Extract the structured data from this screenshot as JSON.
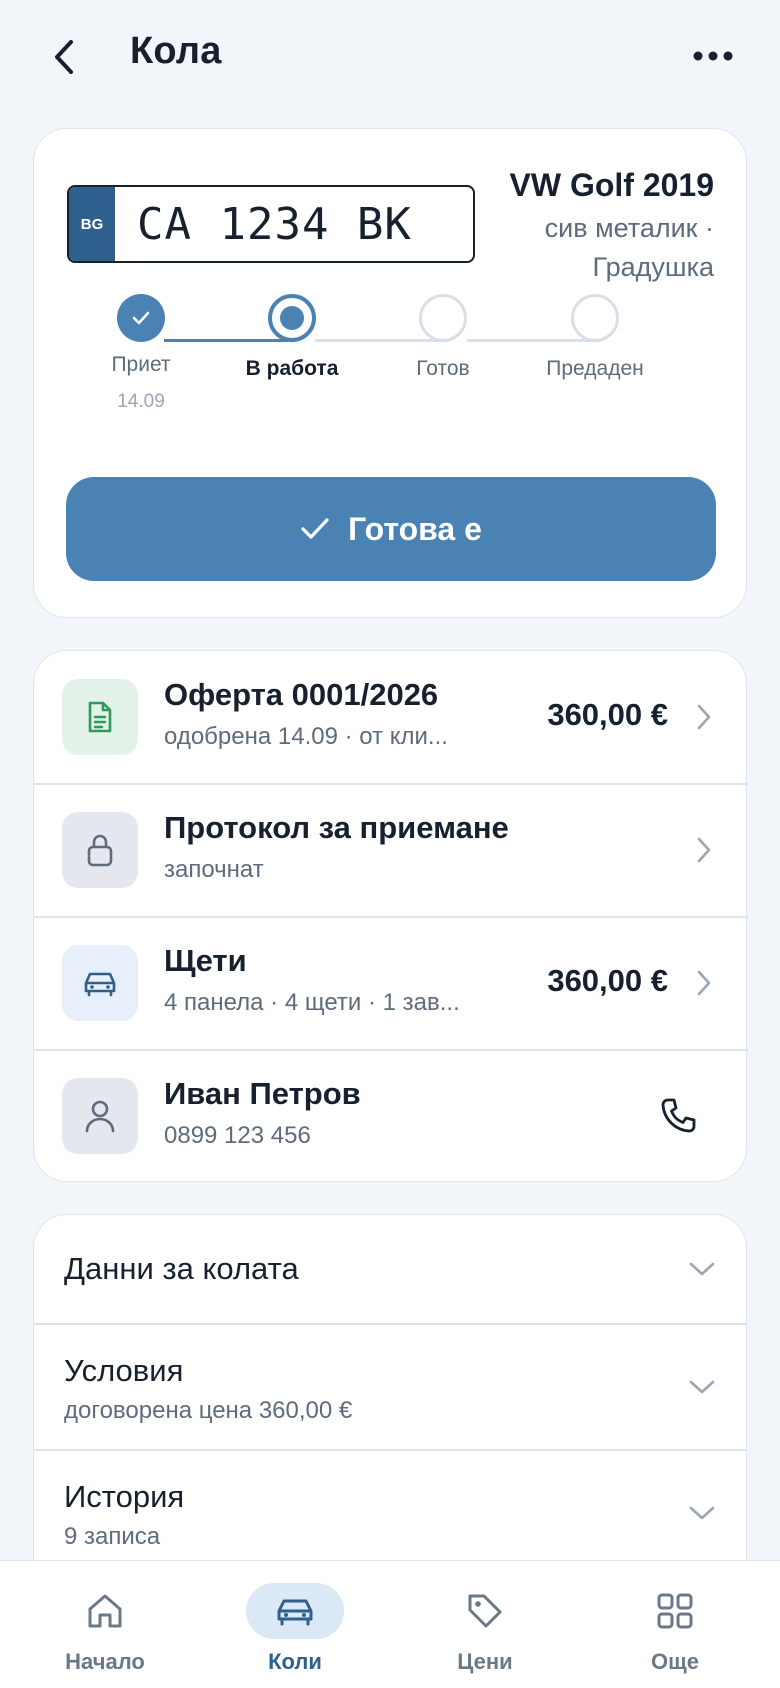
{
  "header": {
    "title": "Кола",
    "back_icon": "chevron-left-icon",
    "more_icon": "more-horizontal-icon"
  },
  "vehicle": {
    "plate_country": "BG",
    "plate_number": "CA 1234 BK",
    "model": "VW Golf 2019",
    "color_line1": "сив металик ·",
    "color_line2": "Градушка"
  },
  "stepper": {
    "steps": [
      {
        "label": "Приет",
        "date": "14.09",
        "state": "done"
      },
      {
        "label": "В работа",
        "date": "",
        "state": "current"
      },
      {
        "label": "Готов",
        "date": "",
        "state": "pending"
      },
      {
        "label": "Предаден",
        "date": "",
        "state": "pending"
      }
    ]
  },
  "primary_action": {
    "label": "Готова е",
    "icon": "check-icon"
  },
  "rows": [
    {
      "title": "Оферта 0001/2026",
      "subtitle": "одобрена 14.09 · от кли...",
      "amount": "360,00 €",
      "icon": "document-icon"
    },
    {
      "title": "Протокол за приемане",
      "subtitle": "започнат",
      "amount": "",
      "icon": "lock-icon"
    },
    {
      "title": "Щети",
      "subtitle": "4 панела · 4 щети · 1 зав...",
      "amount": "360,00 €",
      "icon": "car-icon"
    },
    {
      "title": "Иван Петров",
      "subtitle": "0899 123 456",
      "amount": "",
      "icon": "user-icon"
    }
  ],
  "accordion": [
    {
      "title": "Данни за колата",
      "subtitle": ""
    },
    {
      "title": "Условия",
      "subtitle": "договорена цена 360,00 €"
    },
    {
      "title": "История",
      "subtitle": "9 записа"
    }
  ],
  "tabs": [
    {
      "label": "Начало",
      "icon": "home-icon",
      "active": false
    },
    {
      "label": "Коли",
      "icon": "car-icon",
      "active": true
    },
    {
      "label": "Цени",
      "icon": "tag-icon",
      "active": false
    },
    {
      "label": "Още",
      "icon": "grid-icon",
      "active": false
    }
  ],
  "colors": {
    "accent": "#4a82b4",
    "accent_dark": "#2f5f8c",
    "background": "#f2f5f9",
    "offer_icon_bg": "#e3f3ea",
    "neutral_icon_bg": "#e4e8ee",
    "car_icon_bg": "#e7f0fa"
  }
}
